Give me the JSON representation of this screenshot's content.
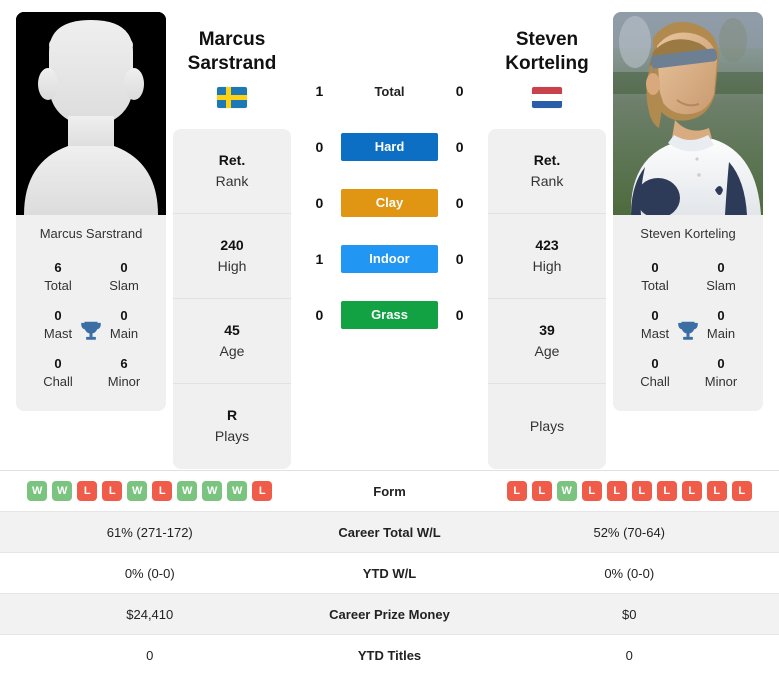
{
  "players": {
    "left": {
      "name": "Marcus Sarstrand",
      "name_line1": "Marcus",
      "name_line2": "Sarstrand",
      "country": "Sweden",
      "flag_icon": "flag-sweden-icon",
      "photo_type": "placeholder-silhouette",
      "photo_alt": "Marcus Sarstrand placeholder photo",
      "card_name": "Marcus Sarstrand",
      "rank": {
        "rank_value": "Ret.",
        "rank_label": "Rank",
        "high_value": "240",
        "high_label": "High",
        "age_value": "45",
        "age_label": "Age",
        "plays_value": "R",
        "plays_label": "Plays"
      },
      "titles": {
        "total_value": "6",
        "total_label": "Total",
        "slam_value": "0",
        "slam_label": "Slam",
        "mast_value": "0",
        "mast_label": "Mast",
        "main_value": "0",
        "main_label": "Main",
        "chall_value": "0",
        "chall_label": "Chall",
        "minor_value": "6",
        "minor_label": "Minor"
      },
      "form": [
        "W",
        "W",
        "L",
        "L",
        "W",
        "L",
        "W",
        "W",
        "W",
        "L"
      ]
    },
    "right": {
      "name": "Steven Korteling",
      "name_line1": "Steven",
      "name_line2": "Korteling",
      "country": "Netherlands",
      "flag_icon": "flag-netherlands-icon",
      "photo_type": "photo",
      "photo_alt": "Steven Korteling photo",
      "card_name": "Steven Korteling",
      "rank": {
        "rank_value": "Ret.",
        "rank_label": "Rank",
        "high_value": "423",
        "high_label": "High",
        "age_value": "39",
        "age_label": "Age",
        "plays_value": "",
        "plays_label": "Plays"
      },
      "titles": {
        "total_value": "0",
        "total_label": "Total",
        "slam_value": "0",
        "slam_label": "Slam",
        "mast_value": "0",
        "mast_label": "Mast",
        "main_value": "0",
        "main_label": "Main",
        "chall_value": "0",
        "chall_label": "Chall",
        "minor_value": "0",
        "minor_label": "Minor"
      },
      "form": [
        "L",
        "L",
        "W",
        "L",
        "L",
        "L",
        "L",
        "L",
        "L",
        "L"
      ]
    }
  },
  "h2h": {
    "rows": [
      {
        "label": "Total",
        "left": "1",
        "right": "0",
        "style": "plain",
        "color": ""
      },
      {
        "label": "Hard",
        "left": "0",
        "right": "0",
        "style": "surface",
        "color": "#0D6FC4"
      },
      {
        "label": "Clay",
        "left": "0",
        "right": "0",
        "style": "surface",
        "color": "#E09612"
      },
      {
        "label": "Indoor",
        "left": "1",
        "right": "0",
        "style": "surface",
        "color": "#2196F3"
      },
      {
        "label": "Grass",
        "left": "0",
        "right": "0",
        "style": "surface",
        "color": "#12A244"
      }
    ]
  },
  "stats_table": {
    "rows": [
      {
        "label": "Form",
        "left": "",
        "right": "",
        "type": "form"
      },
      {
        "label": "Career Total W/L",
        "left": "61% (271-172)",
        "right": "52% (70-64)",
        "type": "text"
      },
      {
        "label": "YTD W/L",
        "left": "0% (0-0)",
        "right": "0% (0-0)",
        "type": "text"
      },
      {
        "label": "Career Prize Money",
        "left": "$24,410",
        "right": "$0",
        "type": "text"
      },
      {
        "label": "YTD Titles",
        "left": "0",
        "right": "0",
        "type": "text"
      }
    ]
  },
  "icons": {
    "trophy": "trophy-icon"
  },
  "colors": {
    "win": "#7AC47F",
    "loss": "#F05C4A",
    "hard": "#0D6FC4",
    "clay": "#E09612",
    "indoor": "#2196F3",
    "grass": "#12A244",
    "trophy": "#3A6EA5",
    "card_bg": "#f0f0f0"
  }
}
